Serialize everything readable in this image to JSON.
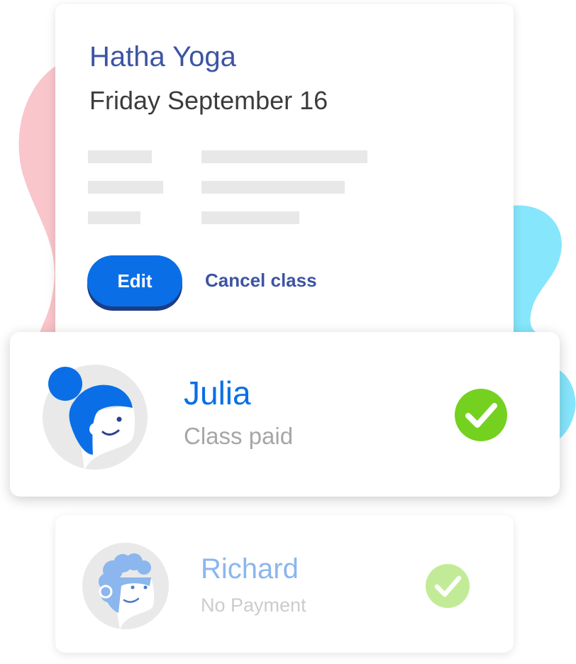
{
  "class_card": {
    "title": "Hatha Yoga",
    "date": "Friday September 16",
    "edit_label": "Edit",
    "cancel_label": "Cancel class"
  },
  "attendees": [
    {
      "name": "Julia",
      "status": "Class paid",
      "avatar_icon": "woman-avatar-icon",
      "check_icon": "checkmark-circle-icon",
      "check_color": "#74d11f"
    },
    {
      "name": "Richard",
      "status": "No Payment",
      "avatar_icon": "man-avatar-icon",
      "check_icon": "checkmark-circle-icon",
      "check_color": "#c2eb97"
    }
  ],
  "colors": {
    "title": "#3d54a3",
    "accent": "#0a6fe6",
    "button_shadow": "#1c3c86",
    "blob_pink": "#f9c6cb",
    "blob_cyan": "#86e6fb"
  }
}
